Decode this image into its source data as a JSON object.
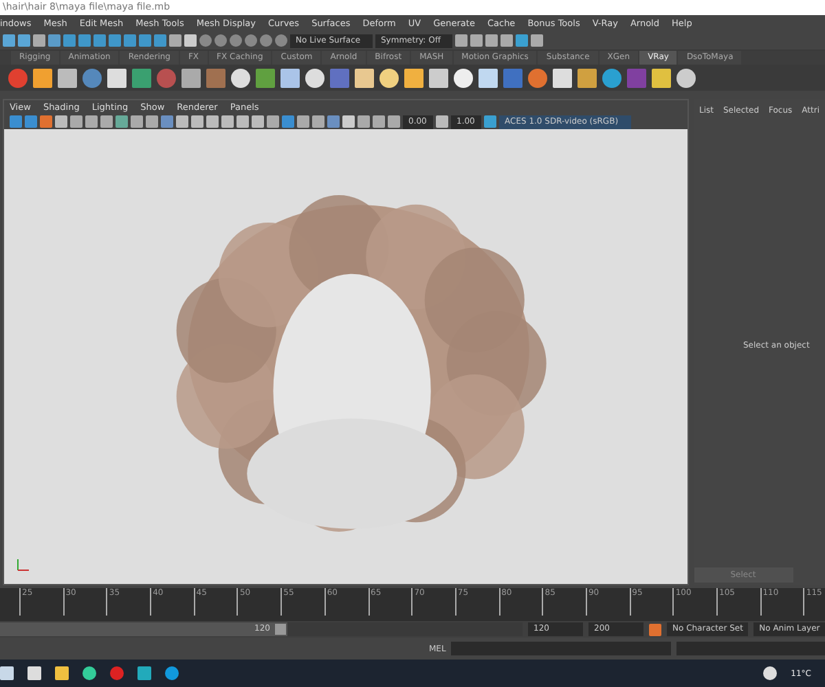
{
  "window": {
    "title": "\\hair\\hair 8\\maya file\\maya file.mb"
  },
  "menu": [
    "indows",
    "Mesh",
    "Edit Mesh",
    "Mesh Tools",
    "Mesh Display",
    "Curves",
    "Surfaces",
    "Deform",
    "UV",
    "Generate",
    "Cache",
    "Bonus Tools",
    "V-Ray",
    "Arnold",
    "Help"
  ],
  "status_line": {
    "live_surface": "No Live Surface",
    "symmetry": "Symmetry: Off"
  },
  "shelf_tabs": [
    {
      "label": "Rigging",
      "selected": false
    },
    {
      "label": "Animation",
      "selected": false
    },
    {
      "label": "Rendering",
      "selected": false
    },
    {
      "label": "FX",
      "selected": false
    },
    {
      "label": "FX Caching",
      "selected": false
    },
    {
      "label": "Custom",
      "selected": false
    },
    {
      "label": "Arnold",
      "selected": false
    },
    {
      "label": "Bifrost",
      "selected": false
    },
    {
      "label": "MASH",
      "selected": false
    },
    {
      "label": "Motion Graphics",
      "selected": false
    },
    {
      "label": "Substance",
      "selected": false
    },
    {
      "label": "XGen",
      "selected": false
    },
    {
      "label": "VRay",
      "selected": true
    },
    {
      "label": "DsoToMaya",
      "selected": false
    }
  ],
  "panel_menu": [
    "View",
    "Shading",
    "Lighting",
    "Show",
    "Renderer",
    "Panels"
  ],
  "viewport_toolbar": {
    "exposure": "0.00",
    "gamma": "1.00",
    "color_space": "ACES 1.0 SDR-video (sRGB)"
  },
  "side_panel": {
    "tabs": [
      "List",
      "Selected",
      "Focus",
      "Attri"
    ],
    "message": "Select an object",
    "button": "Select"
  },
  "timeline": {
    "ticks": [
      "25",
      "30",
      "35",
      "40",
      "45",
      "50",
      "55",
      "60",
      "65",
      "70",
      "75",
      "80",
      "85",
      "90",
      "95",
      "100",
      "105",
      "110",
      "115"
    ]
  },
  "range": {
    "level": 0.55,
    "slider_end": "120",
    "start": "120",
    "end": "200",
    "character_set": "No Character Set",
    "anim_layer": "No Anim Layer"
  },
  "command_line": {
    "language": "MEL"
  },
  "taskbar": {
    "weather": "11°C"
  }
}
